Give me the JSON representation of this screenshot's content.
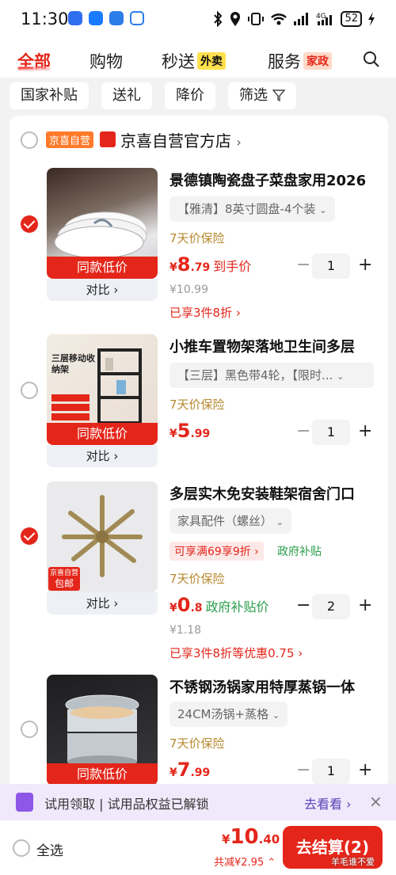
{
  "status": {
    "time": "11:30",
    "battery": "52"
  },
  "tabs": {
    "all": "全部",
    "shopping": "购物",
    "instant": "秒送",
    "instant_tag": "外卖",
    "service": "服务",
    "service_tag": "家政"
  },
  "chips": [
    "国家补贴",
    "送礼",
    "降价",
    "筛选"
  ],
  "store": {
    "badge": "京喜自营",
    "name": "京喜自营官方店"
  },
  "items": [
    {
      "title": "景德镇陶瓷盘子菜盘家用2026",
      "spec": "【雅清】8英寸圆盘-4个装",
      "guarantee": "7天价保险",
      "price_int": "8",
      "price_dec": ".79",
      "price_note": "到手价",
      "original": "¥10.99",
      "promo": "已享3件8折",
      "qty": "1",
      "band": "同款低价",
      "compare": "对比"
    },
    {
      "title": "小推车置物架落地卫生间多层",
      "spec": "【三层】黑色带4轮，【限时...",
      "guarantee": "7天价保险",
      "price_int": "5",
      "price_dec": ".99",
      "qty": "1",
      "band": "同款低价",
      "compare": "对比",
      "thumb_text": "三层移动收纳架"
    },
    {
      "title": "多层实木免安装鞋架宿舍门口",
      "spec": "家具配件（螺丝）",
      "coupon": "可享满69享9折",
      "subsidy": "政府补贴",
      "guarantee": "7天价保险",
      "price_int": "0",
      "price_dec": ".8",
      "price_note": "政府补贴价",
      "original": "¥1.18",
      "promo": "已享3件8折等优惠0.75",
      "qty": "2",
      "badge_top": "京喜自营",
      "badge_bottom": "包邮",
      "compare": "对比"
    },
    {
      "title": "不锈钢汤锅家用特厚蒸锅一体",
      "spec": "24CM汤锅+蒸格",
      "guarantee": "7天价保险",
      "price_int": "7",
      "price_dec": ".99",
      "qty": "1",
      "band": "同款低价"
    }
  ],
  "trial": {
    "text": "试用领取 | 试用品权益已解锁",
    "link": "去看看"
  },
  "bottom": {
    "select_all": "全选",
    "total_int": "10",
    "total_dec": ".40",
    "discount": "共减¥2.95",
    "checkout": "去结算(2)",
    "watermark": "羊毛谁不爱"
  }
}
